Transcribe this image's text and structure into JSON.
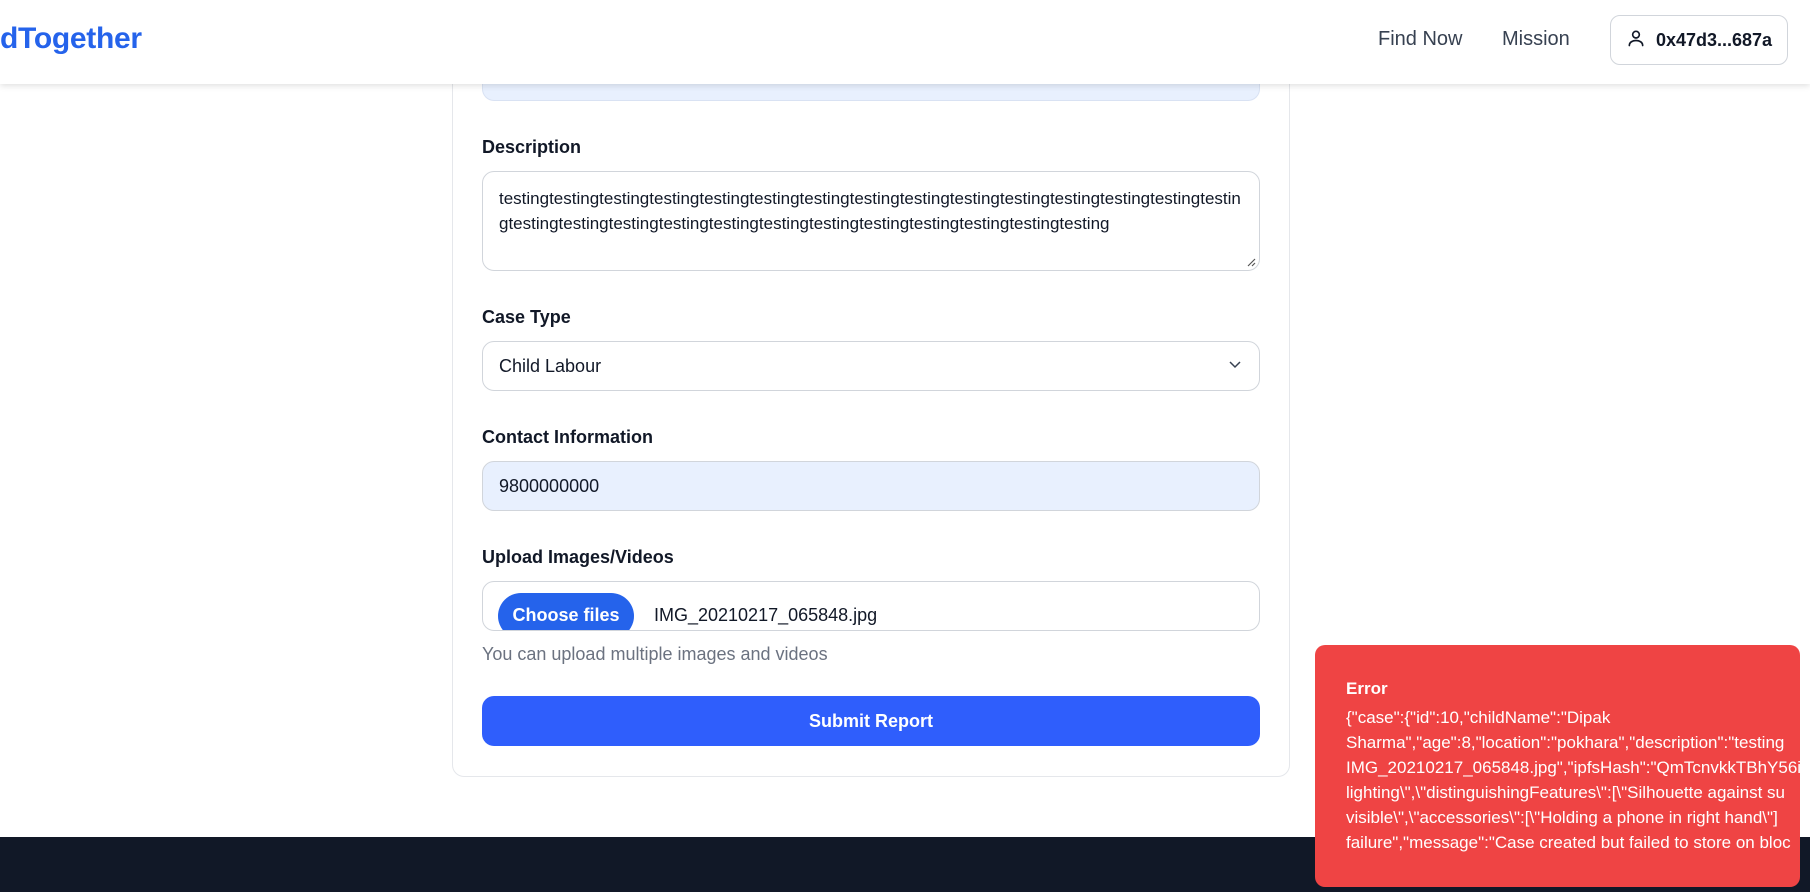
{
  "header": {
    "brand": "dTogether",
    "nav": {
      "find_now": "Find Now",
      "mission": "Mission"
    },
    "wallet": {
      "address": "0x47d3...687a",
      "icon": "user-icon"
    }
  },
  "form": {
    "description": {
      "label": "Description",
      "value": "testingtestingtestingtestingtestingtestingtestingtestingtestingtestingtestingtestingtestingtestingtestingtestingtestingtestingtestingtestingtestingtestingtestingtestingtestingtestingtesting"
    },
    "case_type": {
      "label": "Case Type",
      "value": "Child Labour",
      "icon": "chevron-down-icon"
    },
    "contact": {
      "label": "Contact Information",
      "value": "9800000000"
    },
    "upload": {
      "label": "Upload Images/Videos",
      "button": "Choose files",
      "file_name": "IMG_20210217_065848.jpg",
      "hint": "You can upload multiple images and videos"
    },
    "submit": "Submit Report"
  },
  "toast": {
    "title": "Error",
    "message": "{\"case\":{\"id\":10,\"childName\":\"Dipak\nSharma\",\"age\":8,\"location\":\"pokhara\",\"description\":\"testing\nIMG_20210217_065848.jpg\",\"ipfsHash\":\"QmTcnvkkTBhY56i:\nlighting\\\",\\\"distinguishingFeatures\\\":[\\\"Silhouette against su\nvisible\\\",\\\"accessories\\\":[\\\"Holding a phone in right hand\\\"]\nfailure\",\"message\":\"Case created but failed to store on bloc"
  },
  "colors": {
    "brand": "#2563eb",
    "submit": "#2f5efc",
    "error": "#ef4444",
    "footer": "#111827",
    "autofill": "#e8f0fe"
  }
}
